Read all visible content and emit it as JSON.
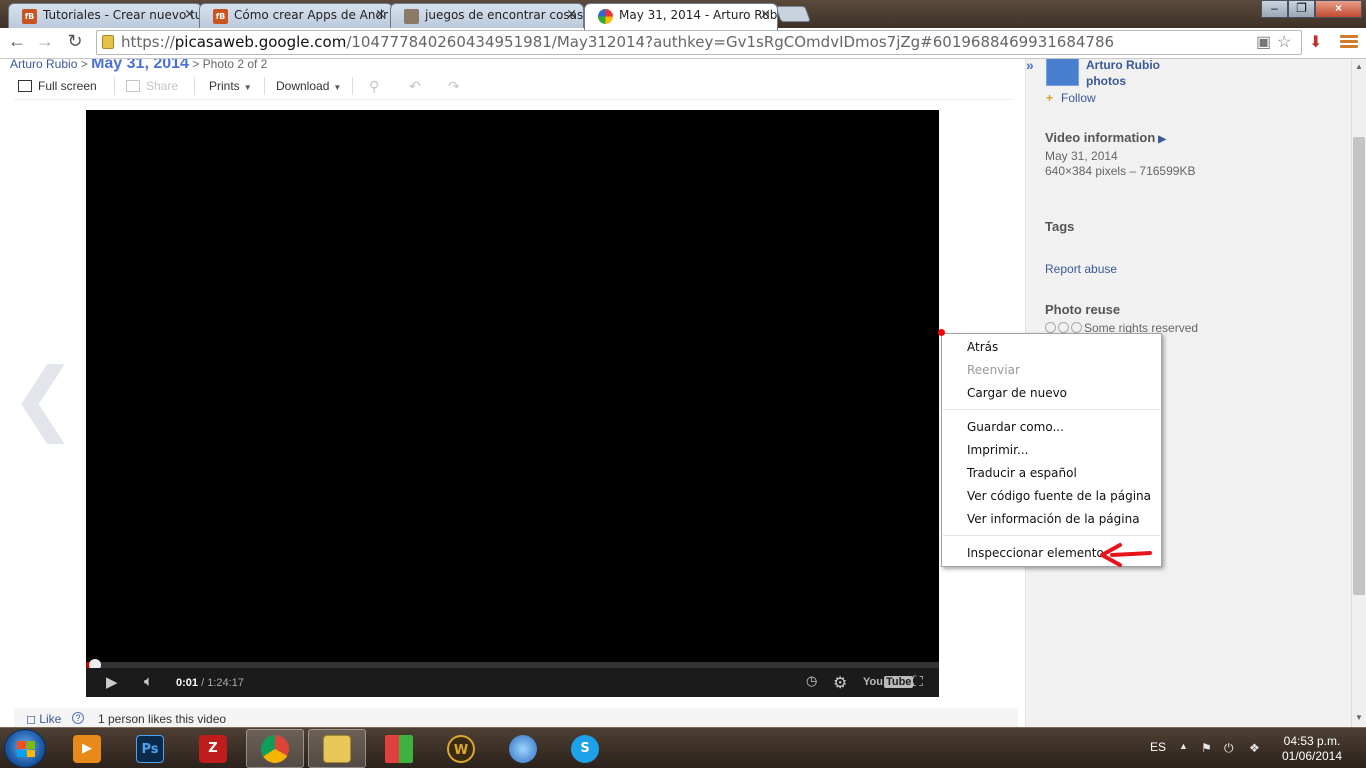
{
  "browser": {
    "tabs": [
      {
        "title": "Tutoriales - Crear nuevo tu",
        "favicon": "fb-badge-icon",
        "active": false
      },
      {
        "title": "Cómo crear Apps de Andr",
        "favicon": "fb-badge-icon",
        "active": false
      },
      {
        "title": "juegos de encontrar cosas",
        "favicon": "game-thumbnail-icon",
        "active": false
      },
      {
        "title": "May 31, 2014 - Arturo Rub",
        "favicon": "picasa-icon",
        "active": true
      }
    ],
    "tab_close_glyph": "×",
    "window_controls": {
      "minimize": "–",
      "maximize": "❐",
      "close": "×"
    },
    "url_prefix": "https://",
    "url_domain": "picasaweb.google.com",
    "url_path": "/104777840260434951981/May312014?authkey=Gv1sRgCOmdvIDmos7jZg#6019688469931684786",
    "nav": {
      "back": "←",
      "forward": "→",
      "reload": "↻"
    }
  },
  "page": {
    "breadcrumb": {
      "owner": "Arturo Rubio",
      "sep1": ">",
      "album": "May 31, 2014",
      "sep2": ">",
      "position": "Photo 2 of 2"
    },
    "tools": {
      "fullscreen": "Full screen",
      "share": "Share",
      "prints": "Prints",
      "download": "Download"
    },
    "prev_arrow": "❮",
    "player": {
      "current_time": "0:01",
      "duration": "/ 1:24:17",
      "youtube_word": "You",
      "youtube_tube": "Tube",
      "progress_fraction": 0.001
    },
    "like": {
      "label": "Like",
      "help": "?",
      "count_text": "1 person likes this video"
    }
  },
  "sidebar": {
    "collapse": "»",
    "owner_line1": "Arturo Rubio",
    "owner_line2": "photos",
    "follow": "Follow",
    "video_info_heading": "Video information",
    "date": "May 31, 2014",
    "dimensions": "640×384 pixels – 716599KB",
    "tags_heading": "Tags",
    "report_abuse": "Report abuse",
    "photo_reuse_heading": "Photo reuse",
    "rights": "Some rights reserved"
  },
  "context_menu": {
    "items": [
      {
        "label": "Atrás",
        "enabled": true
      },
      {
        "label": "Reenviar",
        "enabled": false
      },
      {
        "label": "Cargar de nuevo",
        "enabled": true
      },
      {
        "label": "Guardar como...",
        "enabled": true
      },
      {
        "label": "Imprimir...",
        "enabled": true
      },
      {
        "label": "Traducir a español",
        "enabled": true
      },
      {
        "label": "Ver código fuente de la página",
        "enabled": true
      },
      {
        "label": "Ver información de la página",
        "enabled": true
      },
      {
        "label": "Inspeccionar elemento",
        "enabled": true
      }
    ],
    "annotation_color": "#e8141b"
  },
  "taskbar": {
    "apps": [
      {
        "name": "media-player-icon"
      },
      {
        "name": "photoshop-icon",
        "label": "Ps"
      },
      {
        "name": "filezilla-icon",
        "label": "Z"
      },
      {
        "name": "chrome-icon",
        "active": true
      },
      {
        "name": "file-explorer-icon",
        "active": true
      },
      {
        "name": "tiles-app-icon"
      },
      {
        "name": "world-of-warcraft-icon",
        "label": "W"
      },
      {
        "name": "globe-app-icon"
      },
      {
        "name": "skype-icon",
        "label": "S"
      }
    ],
    "language": "ES",
    "time": "04:53 p.m.",
    "date": "01/06/2014"
  },
  "colors": {
    "link": "#3b5998",
    "album_title": "#4a6fd8",
    "chrome_menu": "#d27b2c",
    "progress_played": "#bb0000"
  }
}
